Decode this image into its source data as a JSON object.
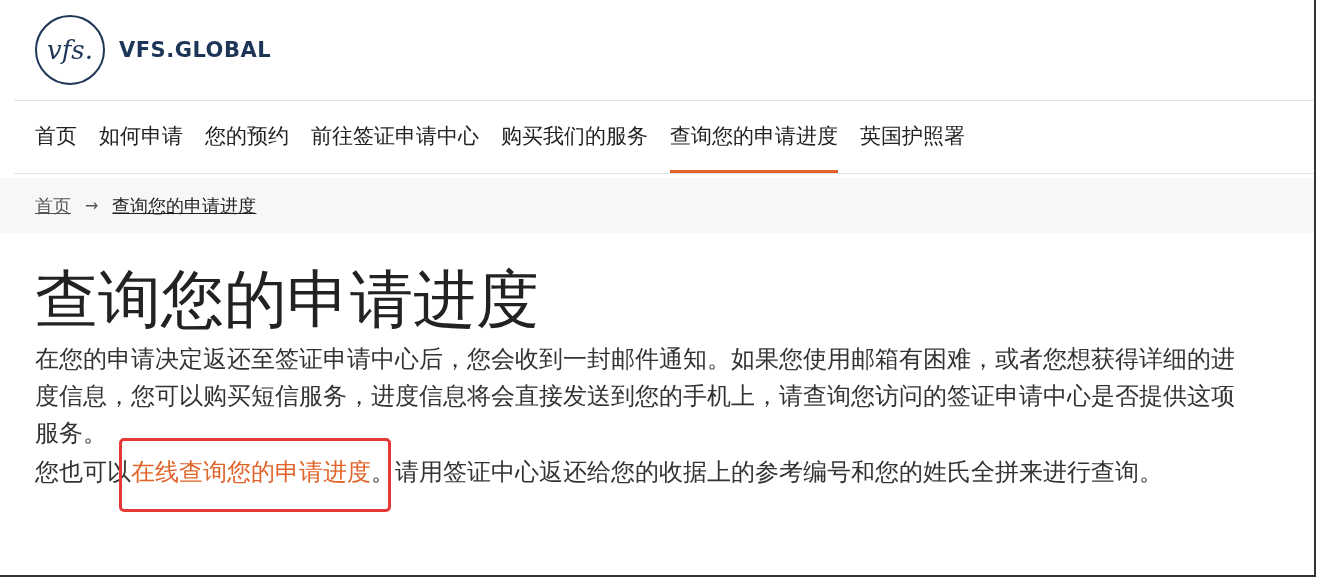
{
  "logo": {
    "mark": "vfs.",
    "name": "VFS.GLOBAL"
  },
  "nav": [
    {
      "label": "首页",
      "selected": false
    },
    {
      "label": "如何申请",
      "selected": false
    },
    {
      "label": "您的预约",
      "selected": false
    },
    {
      "label": "前往签证申请中心",
      "selected": false
    },
    {
      "label": "购买我们的服务",
      "selected": false
    },
    {
      "label": "查询您的申请进度",
      "selected": true
    },
    {
      "label": "英国护照署",
      "selected": false
    }
  ],
  "breadcrumb": {
    "items": [
      "首页",
      "查询您的申请进度"
    ],
    "separator": "→"
  },
  "title": "查询您的申请进度",
  "paragraphs": [
    {
      "text": "在您的申请决定返还至签证申请中心后，您会收到一封邮件通知。如果您使用邮箱有困难，或者您想获得详细的进度信息，您可以购买短信服务，进度信息将会直接发送到您的手机上，请查询您访问的签证申请中心是否提供这项服务。"
    },
    {
      "text": "您也可以",
      "link": {
        "label": "在线查询您的申请进度",
        "highlighted": true
      },
      "after": "。请用签证中心返还给您的收据上的参考编号和您的姓氏全拼来进行查询。"
    }
  ]
}
